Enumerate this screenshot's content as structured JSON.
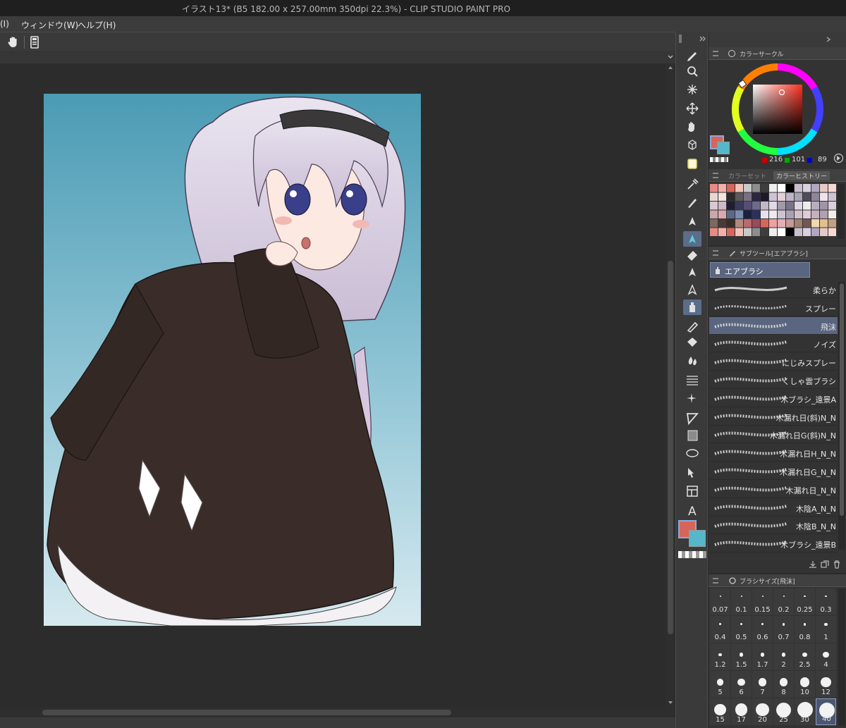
{
  "window": {
    "title": "イラスト13* (B5 182.00 x 257.00mm 350dpi 22.3%)  - CLIP STUDIO PAINT PRO"
  },
  "menu": {
    "items": [
      "(I)",
      "ウィンドウ(W)",
      "ヘルプ(H)"
    ]
  },
  "commandbar": {
    "icons": [
      "hand-icon",
      "device-icon"
    ]
  },
  "tools": [
    "pen-icon",
    "zoom-icon",
    "auto-select-icon",
    "move-icon",
    "hand-icon",
    "3d-icon",
    "layer-move-icon",
    "eyedropper-icon",
    "pen-tool-icon",
    "pencil-icon",
    "brush-icon",
    "airbrush-icon",
    "eraser-icon",
    "deco-icon",
    "fill-icon",
    "gradient-icon",
    "blend-icon",
    "ruler-icon",
    "text-icon"
  ],
  "color_circle": {
    "tab_label": "カラーサークル",
    "r": "216",
    "g": "101",
    "b": "89",
    "main_color": "#d86559",
    "sub_color": "#56b7c8"
  },
  "color_set": {
    "tabs": [
      "カラーセット",
      "カラーヒストリー"
    ]
  },
  "subtool": {
    "tab_label": "サブツール[エアブラシ]",
    "group_label": "エアブラシ",
    "brushes": [
      {
        "name": "柔らか",
        "selected": false
      },
      {
        "name": "スプレー",
        "selected": false
      },
      {
        "name": "飛沫",
        "selected": true
      },
      {
        "name": "ノイズ",
        "selected": false
      },
      {
        "name": "にじみスプレー",
        "selected": false
      },
      {
        "name": "くしゃ雲ブラシ",
        "selected": false
      },
      {
        "name": "木ブラシ_遠景A",
        "selected": false
      },
      {
        "name": "木漏れ日(斜)N_N",
        "selected": false
      },
      {
        "name": "木漏れ日G(斜)N_N",
        "selected": false
      },
      {
        "name": "木漏れ日H_N_N",
        "selected": false
      },
      {
        "name": "木漏れ日G_N_N",
        "selected": false
      },
      {
        "name": "木漏れ日_N_N",
        "selected": false
      },
      {
        "name": "木陰A_N_N",
        "selected": false
      },
      {
        "name": "木陰B_N_N",
        "selected": false
      },
      {
        "name": "木ブラシ_遠景B",
        "selected": false
      }
    ]
  },
  "brush_size": {
    "tab_label": "ブラシサイズ[飛沫]",
    "sizes": [
      "0.07",
      "0.1",
      "0.15",
      "0.2",
      "0.25",
      "0.3",
      "0.4",
      "0.5",
      "0.6",
      "0.7",
      "0.8",
      "1",
      "1.2",
      "1.5",
      "1.7",
      "2",
      "2.5",
      "4",
      "5",
      "6",
      "7",
      "8",
      "10",
      "12",
      "15",
      "17",
      "20",
      "25",
      "30",
      "40"
    ],
    "selected": "40"
  }
}
